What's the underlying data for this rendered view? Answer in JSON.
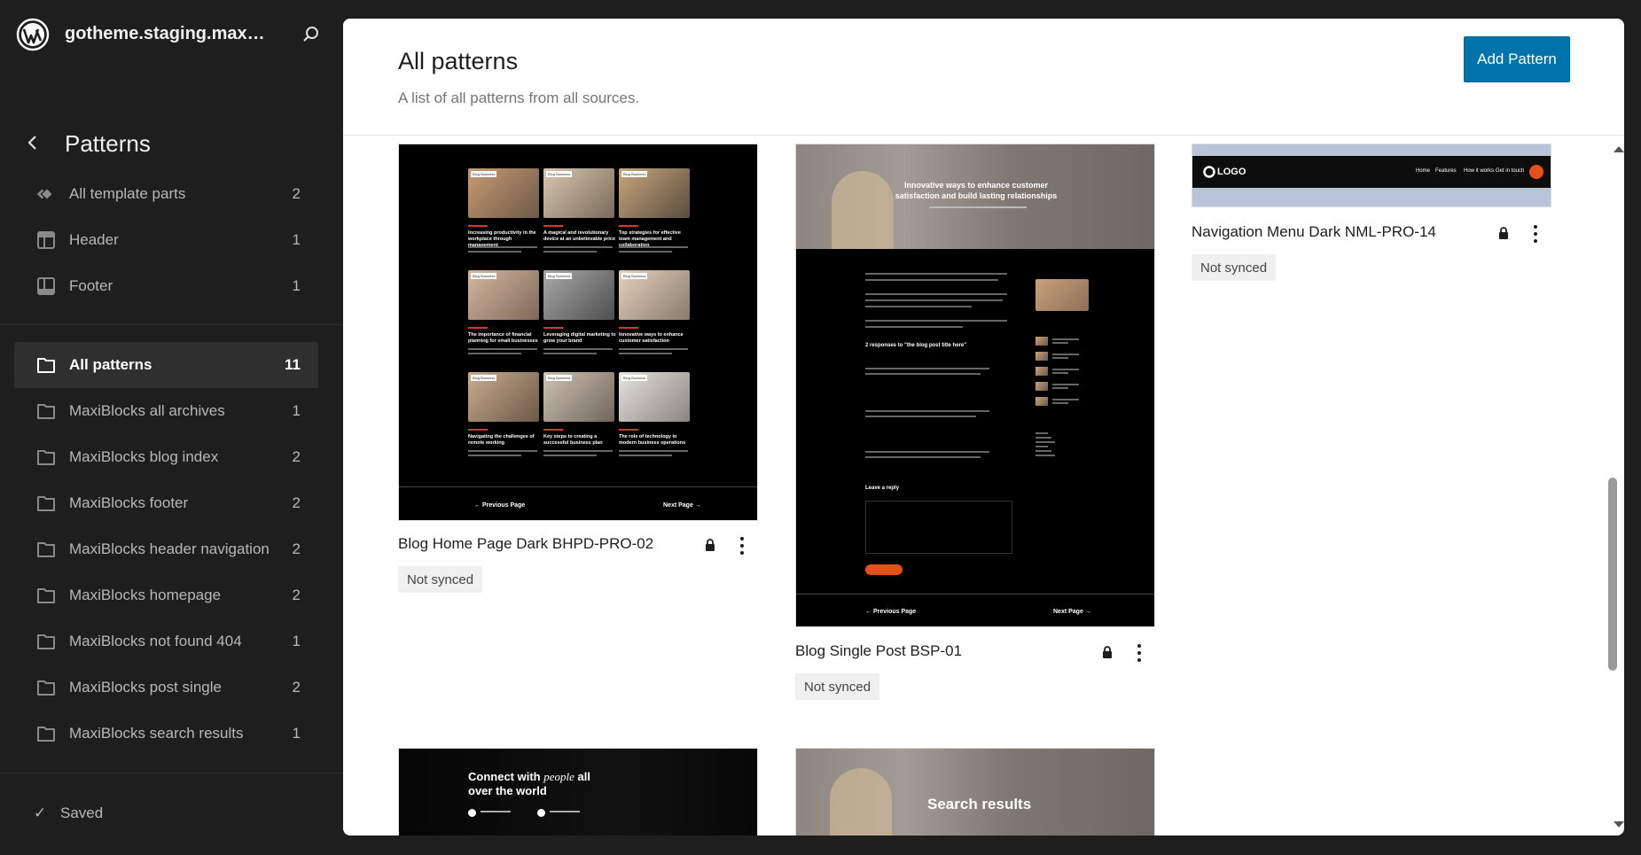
{
  "site": {
    "title": "gotheme.staging.maxib..."
  },
  "nav": {
    "title": "Patterns"
  },
  "template_parts": [
    {
      "label": "All template parts",
      "count": "2",
      "icon": "template-parts-icon"
    },
    {
      "label": "Header",
      "count": "1",
      "icon": "header-layout-icon"
    },
    {
      "label": "Footer",
      "count": "1",
      "icon": "footer-layout-icon"
    }
  ],
  "categories": [
    {
      "label": "All patterns",
      "count": "11",
      "active": true
    },
    {
      "label": "MaxiBlocks all archives",
      "count": "1"
    },
    {
      "label": "MaxiBlocks blog index",
      "count": "2"
    },
    {
      "label": "MaxiBlocks footer",
      "count": "2"
    },
    {
      "label": "MaxiBlocks header navigation",
      "count": "2"
    },
    {
      "label": "MaxiBlocks homepage",
      "count": "2"
    },
    {
      "label": "MaxiBlocks not found 404",
      "count": "1"
    },
    {
      "label": "MaxiBlocks post single",
      "count": "2"
    },
    {
      "label": "MaxiBlocks search results",
      "count": "1"
    }
  ],
  "footer": {
    "status": "Saved"
  },
  "header": {
    "title": "All patterns",
    "description": "A list of all patterns from all sources.",
    "add_label": "Add Pattern"
  },
  "patterns": [
    {
      "title": "Blog Home Page Dark BHPD-PRO-02",
      "sync": "Not synced",
      "prev": "Previous Page",
      "next": "Next Page",
      "posts": [
        {
          "tag": "Blog Business",
          "headline": "Increasing productivity in the workplace through management"
        },
        {
          "tag": "Blog Business",
          "headline": "A magical and revolutionary device at an unbelievable price"
        },
        {
          "tag": "Blog Business",
          "headline": "Top strategies for effective team management and collaboration"
        },
        {
          "tag": "Blog Business",
          "headline": "The importance of financial planning for small businesses"
        },
        {
          "tag": "Blog Business",
          "headline": "Leveraging digital marketing to grow your brand"
        },
        {
          "tag": "Blog Business",
          "headline": "Innovative ways to enhance customer satisfaction"
        },
        {
          "tag": "Blog Business",
          "headline": "Navigating the challenges of remote working"
        },
        {
          "tag": "Blog Business",
          "headline": "Key steps to creating a successful business plan"
        },
        {
          "tag": "Blog Business",
          "headline": "The role of technology in modern business operations"
        }
      ]
    },
    {
      "title": "Blog Single Post BSP-01",
      "sync": "Not synced",
      "hero": "Innovative ways to enhance customer satisfaction and build lasting relationships",
      "comments_heading": "2 responses to \"the blog post title here\"",
      "reply_heading": "Leave a reply",
      "prev": "Previous Page",
      "next": "Next Page"
    },
    {
      "title": "Navigation Menu Dark NML-PRO-14",
      "sync": "Not synced",
      "logo": "LOGO",
      "menu": [
        "Home",
        "Features",
        "How it works",
        "Get in touch"
      ]
    },
    {
      "headline_a": "Connect with",
      "headline_em": "people",
      "headline_b": "all over the world"
    },
    {
      "headline": "Search results"
    }
  ]
}
